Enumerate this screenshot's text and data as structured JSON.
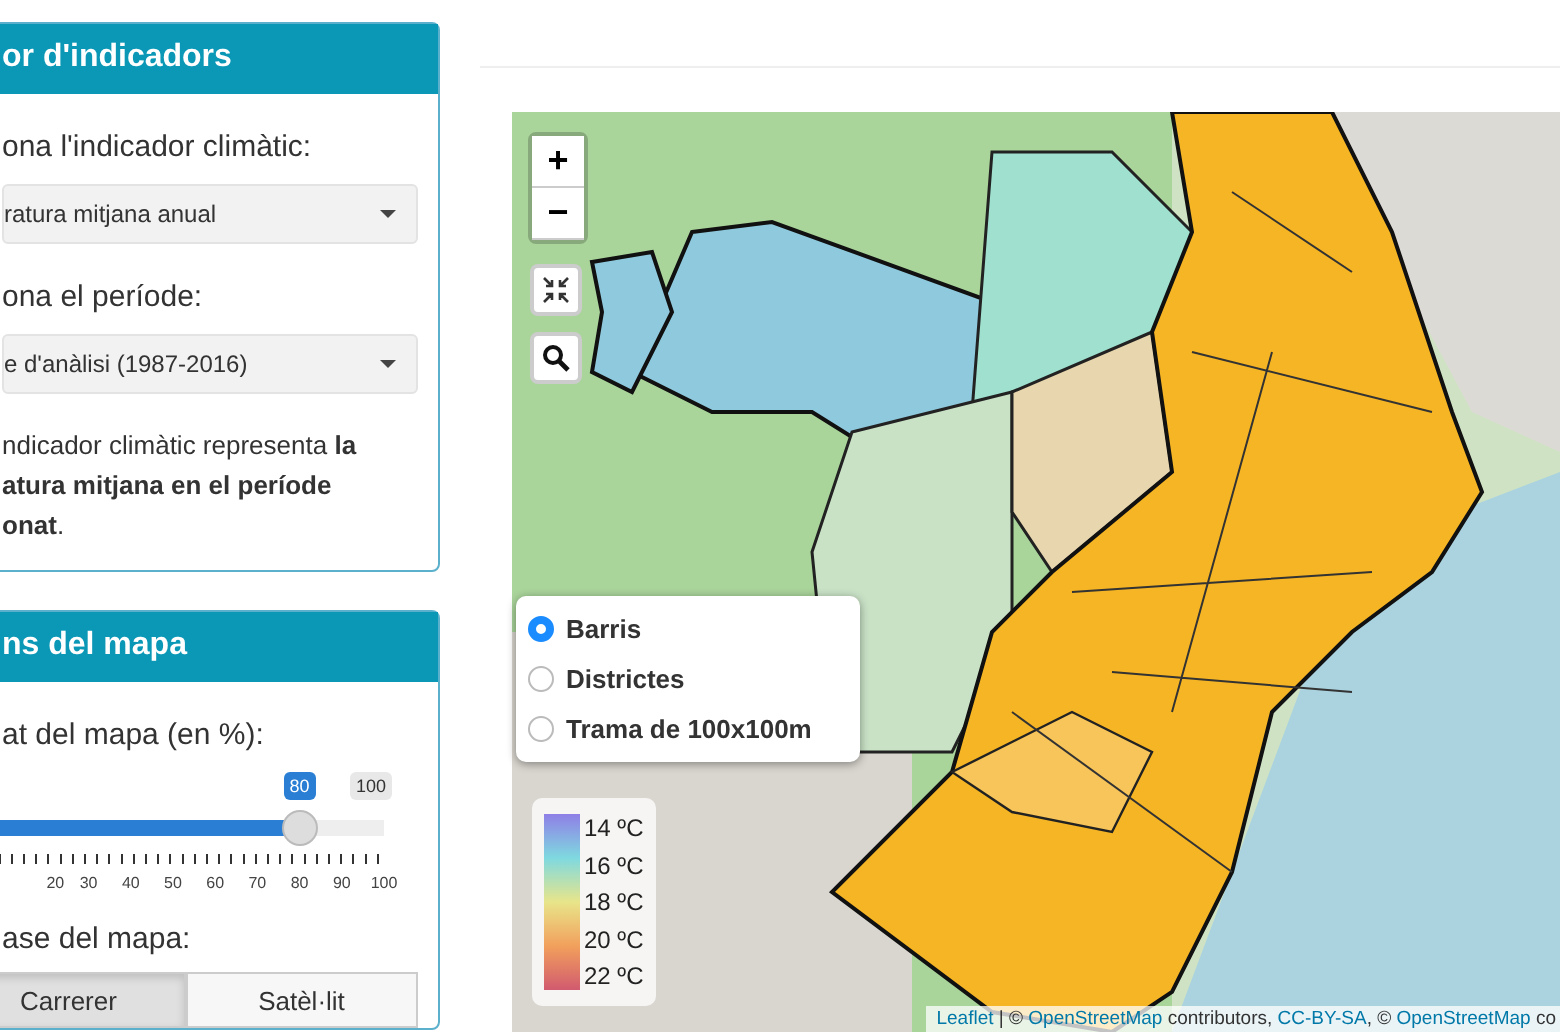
{
  "indicator_panel": {
    "title": "or d'indicadors",
    "indicator_label": "ona l'indicador climàtic:",
    "indicator_value": "ratura mitjana anual",
    "period_label": "ona el període:",
    "period_value": "e d'anàlisi (1987-2016)",
    "description_lines": [
      "ndicador climàtic representa **la**",
      "**atura mitjana en el període**",
      "**onat**."
    ]
  },
  "map_options_panel": {
    "title": "ns del mapa",
    "opacity_label": "at del mapa (en %):",
    "slider": {
      "level": 0.8,
      "value_label": "80",
      "max_label": "100",
      "ticks": [
        "20",
        "30",
        "40",
        "50",
        "60",
        "70",
        "80",
        "90",
        "100"
      ]
    },
    "basemap_label": "ase del mapa:",
    "basemap_buttons": [
      {
        "label": "Carrerer",
        "selected": true
      },
      {
        "label": "Satèl·lit",
        "selected": false
      }
    ]
  },
  "map": {
    "zoom_in": "+",
    "zoom_out": "−",
    "layers": [
      {
        "label": "Barris",
        "selected": true
      },
      {
        "label": "Districtes",
        "selected": false
      },
      {
        "label": "Trama de 100x100m",
        "selected": false
      }
    ],
    "legend": [
      "14 ºC",
      "16 ºC",
      "18 ºC",
      "20 ºC",
      "22 ºC"
    ],
    "attribution": [
      {
        "text": "Leaflet",
        "kind": "link"
      },
      {
        "text": " | © ",
        "kind": "text"
      },
      {
        "text": "OpenStreetMap",
        "kind": "link"
      },
      {
        "text": " contributors, ",
        "kind": "text"
      },
      {
        "text": "CC-BY-SA",
        "kind": "link"
      },
      {
        "text": ", © ",
        "kind": "text"
      },
      {
        "text": "OpenStreetMap",
        "kind": "link"
      },
      {
        "text": " co",
        "kind": "text"
      }
    ]
  }
}
